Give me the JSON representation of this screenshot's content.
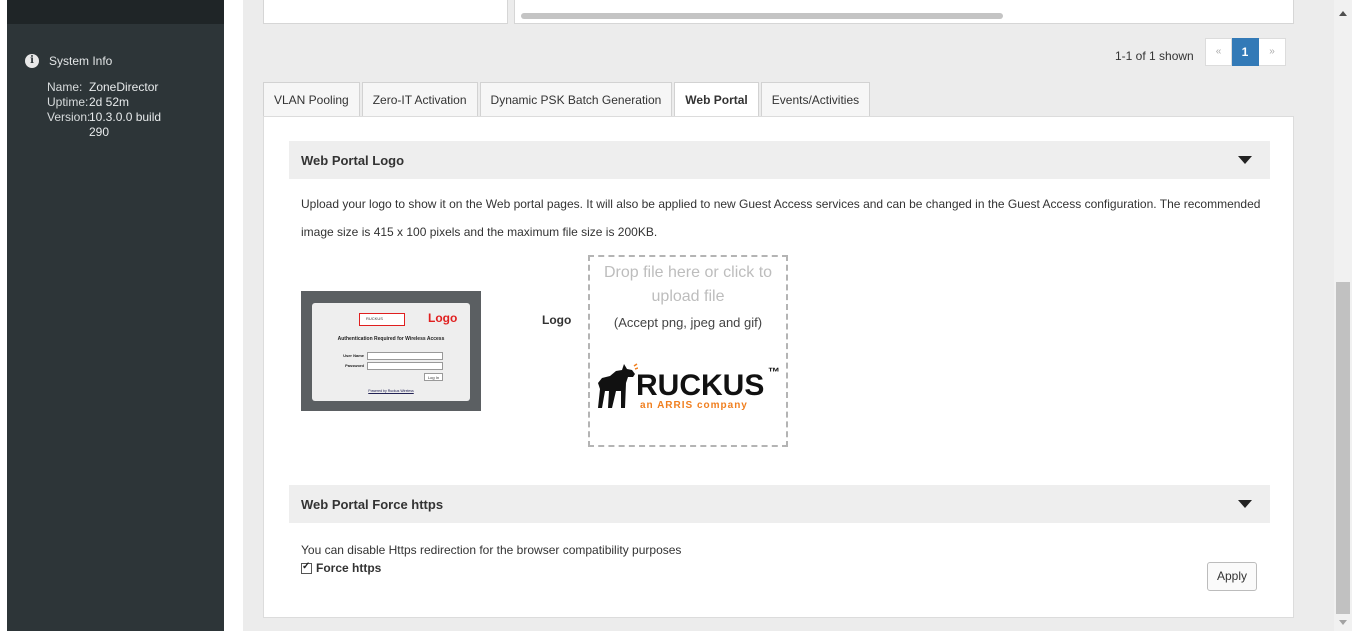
{
  "sidebar": {
    "system_info_title": "System Info",
    "rows": [
      {
        "key": "Name:",
        "value": "ZoneDirector"
      },
      {
        "key": "Uptime:",
        "value": "2d 52m"
      },
      {
        "key": "Version:",
        "value": "10.3.0.0 build 290"
      }
    ]
  },
  "pager": {
    "summary": "1-1 of 1 shown",
    "prev": "«",
    "current": "1",
    "next": "»"
  },
  "tabs": [
    {
      "label": "VLAN Pooling"
    },
    {
      "label": "Zero-IT Activation"
    },
    {
      "label": "Dynamic PSK Batch Generation"
    },
    {
      "label": "Web Portal"
    },
    {
      "label": "Events/Activities"
    }
  ],
  "logo_section": {
    "title": "Web Portal Logo",
    "description": "Upload your logo to show it on the Web portal pages. It will also be applied to new Guest Access services and can be changed in the Guest Access configuration. The recommended image size is 415 x 100 pixels and the maximum file size is 200KB.",
    "logo_label": "Logo",
    "drop_text": "Drop file here or click to upload file",
    "drop_sub": "(Accept png, jpeg and gif)",
    "preview": {
      "logo_label": "Logo",
      "brand": "RUCKUS",
      "auth_title": "Authentication Required for Wireless Access",
      "user_label": "User Name",
      "password_label": "Password",
      "login_button": "Log In",
      "footer": "Powered by Ruckus Wireless"
    },
    "uploaded_logo": {
      "word": "RUCKUS",
      "tm": "™",
      "tagline": "an ARRIS company",
      "color_accent": "#f07f1f"
    }
  },
  "https_section": {
    "title": "Web Portal Force https",
    "description": "You can disable Https redirection for the browser compatibility purposes",
    "checkbox_label": "Force https",
    "checked": true,
    "apply_label": "Apply"
  },
  "colors": {
    "sidebar_bg": "#2d3538",
    "pager_active": "#337ab7",
    "preview_red": "#e01f1f"
  }
}
